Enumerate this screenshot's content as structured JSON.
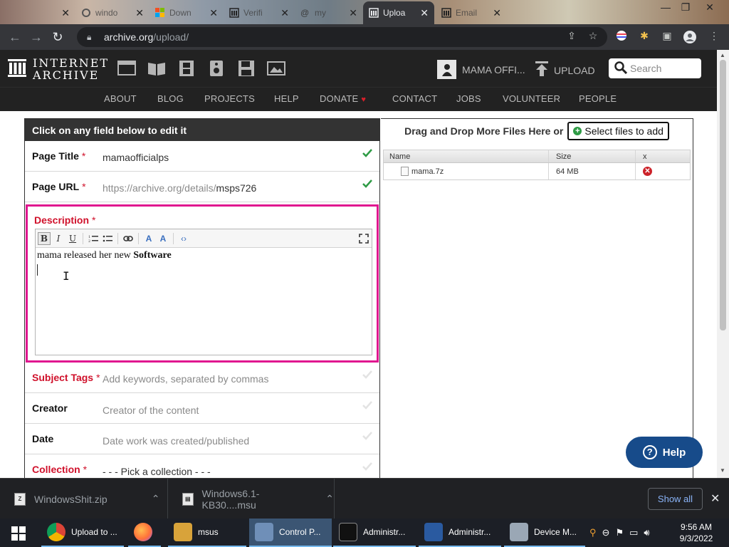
{
  "browser": {
    "tabs": [
      {
        "title": "",
        "active": false
      },
      {
        "title": "windo",
        "active": false
      },
      {
        "title": "Down",
        "active": false
      },
      {
        "title": "Verifi",
        "active": false
      },
      {
        "title": "my",
        "active": false
      },
      {
        "title": "Uploa",
        "active": true
      },
      {
        "title": "Email",
        "active": false
      }
    ],
    "url_host": "archive.org",
    "url_path": "/upload/"
  },
  "ia": {
    "logo_line1": "INTERNET",
    "logo_line2": "ARCHIVE",
    "user_name": "MAMA OFFI...",
    "upload_label": "UPLOAD",
    "search_placeholder": "Search",
    "nav": [
      "ABOUT",
      "BLOG",
      "PROJECTS",
      "HELP",
      "DONATE",
      "CONTACT",
      "JOBS",
      "VOLUNTEER",
      "PEOPLE"
    ]
  },
  "form": {
    "header": "Click on any field below to edit it",
    "page_title_label": "Page Title",
    "page_title_value": "mamaofficialps",
    "page_url_label": "Page URL",
    "page_url_prefix": "https://archive.org/details/",
    "page_url_value": "msps726",
    "description_label": "Description",
    "description_text": "mama released her new ",
    "description_bold": "Software",
    "subject_label": "Subject Tags",
    "subject_placeholder": "Add keywords, separated by commas",
    "creator_label": "Creator",
    "creator_placeholder": "Creator of the content",
    "date_label": "Date",
    "date_placeholder": "Date work was created/published",
    "collection_label": "Collection",
    "collection_placeholder": "- - - Pick a collection - - -",
    "required_mark": "*"
  },
  "files": {
    "drop_text": "Drag and Drop More Files Here or",
    "select_button": "Select files to add",
    "columns": [
      "Name",
      "Size",
      "x"
    ],
    "rows": [
      {
        "name": "mama.7z",
        "size": "64 MB"
      }
    ]
  },
  "help_button": "Help",
  "downloads": {
    "items": [
      "WindowsShit.zip",
      "Windows6.1-KB30....msu"
    ],
    "show_all": "Show all"
  },
  "taskbar": {
    "apps": [
      {
        "label": "Upload to ...",
        "icon": "chrome-icon"
      },
      {
        "label": "",
        "icon": "firefox-icon"
      },
      {
        "label": "msus",
        "icon": "folder-icon"
      },
      {
        "label": "Control P...",
        "icon": "control-panel-icon"
      },
      {
        "label": "Administr...",
        "icon": "cmd-icon"
      },
      {
        "label": "Administr...",
        "icon": "powershell-icon"
      },
      {
        "label": "Device M...",
        "icon": "device-manager-icon"
      }
    ],
    "time": "9:56 AM",
    "date": "9/3/2022"
  },
  "colors": {
    "ia_dark": "#222222",
    "required_red": "#d0112b",
    "focus_pink": "#e0168f",
    "check_green": "#2e9b45",
    "help_blue": "#174b8a",
    "taskbar": "#1c1f26"
  }
}
